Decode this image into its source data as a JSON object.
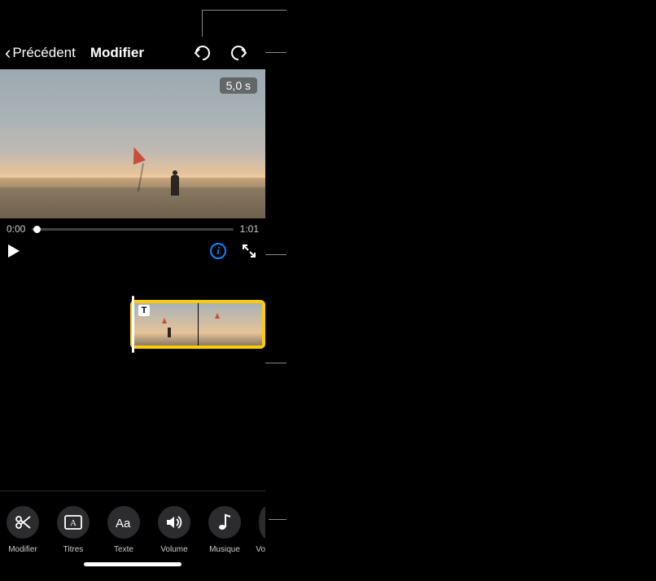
{
  "header": {
    "back_label": "Précédent",
    "title": "Modifier"
  },
  "viewer": {
    "duration_badge": "5,0 s",
    "current_time": "0:00",
    "total_time": "1:01"
  },
  "timeline": {
    "text_badge": "T"
  },
  "tools": [
    {
      "id": "edit",
      "label": "Modifier",
      "icon": "scissors"
    },
    {
      "id": "titles",
      "label": "Titres",
      "icon": "title-frame"
    },
    {
      "id": "text",
      "label": "Texte",
      "icon": "aa"
    },
    {
      "id": "volume",
      "label": "Volume",
      "icon": "speaker"
    },
    {
      "id": "music",
      "label": "Musique",
      "icon": "note"
    },
    {
      "id": "voice",
      "label": "Voix h",
      "icon": "mic"
    }
  ]
}
